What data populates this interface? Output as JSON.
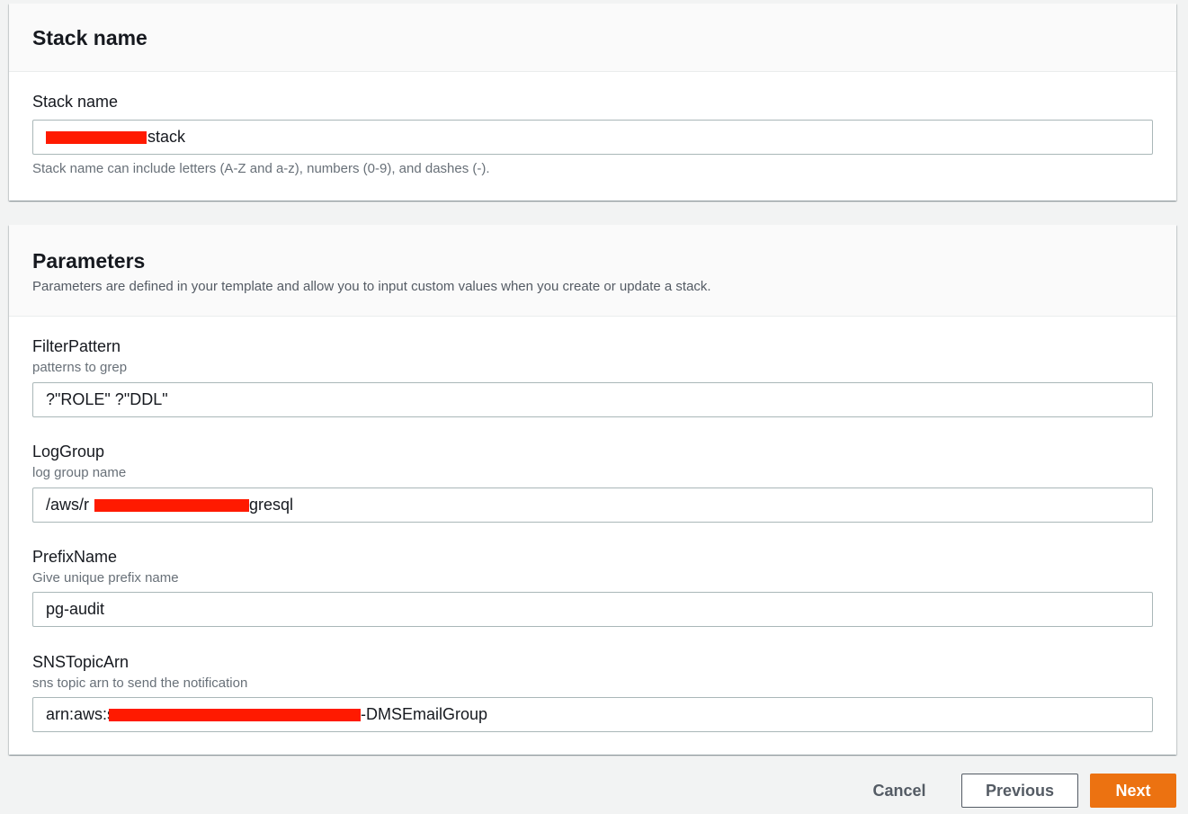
{
  "stack_section": {
    "title": "Stack name",
    "field_label": "Stack name",
    "field_value_visible": "stack",
    "constraint": "Stack name can include letters (A-Z and a-z), numbers (0-9), and dashes (-)."
  },
  "parameters_section": {
    "title": "Parameters",
    "description": "Parameters are defined in your template and allow you to input custom values when you create or update a stack.",
    "fields": [
      {
        "label": "FilterPattern",
        "description": "patterns to grep",
        "value": "?\"ROLE\" ?\"DDL\""
      },
      {
        "label": "LogGroup",
        "description": "log group name",
        "value_prefix": "/aws/r",
        "value_suffix": "gresql"
      },
      {
        "label": "PrefixName",
        "description": "Give unique prefix name",
        "value": "pg-audit"
      },
      {
        "label": "SNSTopicArn",
        "description": "sns topic arn to send the notification",
        "value_prefix": "arn:aws:s",
        "value_suffix": "-DMSEmailGroup"
      }
    ]
  },
  "footer": {
    "cancel_label": "Cancel",
    "previous_label": "Previous",
    "next_label": "Next"
  },
  "colors": {
    "primary_button": "#ec7211",
    "redaction": "#ff1a00"
  }
}
